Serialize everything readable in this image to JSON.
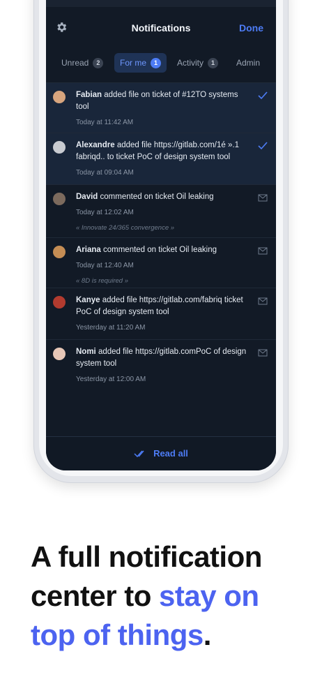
{
  "header": {
    "title": "Notifications",
    "done": "Done"
  },
  "tabs": [
    {
      "label": "Unread",
      "count": "2"
    },
    {
      "label": "For me",
      "count": "1"
    },
    {
      "label": "Activity",
      "count": "1"
    },
    {
      "label": "Admin",
      "count": ""
    }
  ],
  "notifications": [
    {
      "name": "Fabian",
      "text": "added file on ticket of #12TO systems tool",
      "time": "Today at 11:42 AM",
      "quote": "",
      "unread": true,
      "icon": "check-icon",
      "avatar_color": "#d7a57e"
    },
    {
      "name": "Alexandre",
      "text": "added file https://gitlab.com/1é ».1 fabriqd.. to ticket PoC of design system tool",
      "time": "Today at 09:04 AM",
      "quote": "",
      "unread": true,
      "icon": "check-icon",
      "avatar_color": "#c8cbd1"
    },
    {
      "name": "David",
      "text": "commented on ticket Oil leaking",
      "time": "Today at 12:02 AM",
      "quote": "« Innovate 24/365 convergence »",
      "unread": false,
      "icon": "mail-icon",
      "avatar_color": "#7c6a5d"
    },
    {
      "name": "Ariana",
      "text": "commented on ticket Oil leaking",
      "time": "Today at 12:40 AM",
      "quote": "« 8D is required »",
      "unread": false,
      "icon": "mail-icon",
      "avatar_color": "#c58d54"
    },
    {
      "name": "Kanye",
      "text": "added file https://gitlab.com/fabriq ticket PoC of design system tool",
      "time": "Yesterday at 11:20 AM",
      "quote": "",
      "unread": false,
      "icon": "mail-icon",
      "avatar_color": "#b23b2f"
    },
    {
      "name": "Nomi",
      "text": "added file https://gitlab.comPoC of design system tool",
      "time": "Yesterday at 12:00 AM",
      "quote": "",
      "unread": false,
      "icon": "mail-icon",
      "avatar_color": "#e7c7b7"
    }
  ],
  "footer": {
    "read_all": "Read all"
  },
  "headline": {
    "part1": "A full notification center to ",
    "accent": "stay on top of things",
    "part2": "."
  },
  "colors": {
    "accent": "#4D7CF5",
    "background": "#121A26"
  }
}
